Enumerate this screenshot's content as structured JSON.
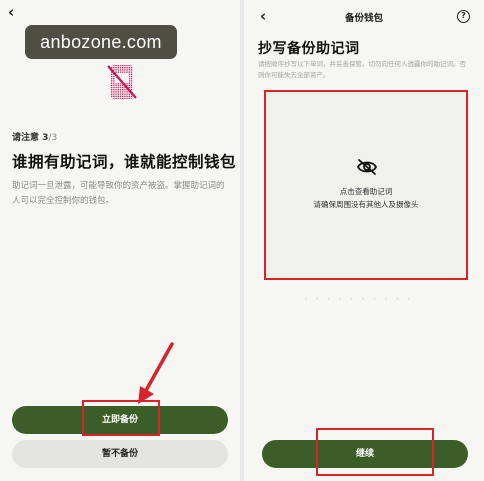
{
  "left_screen": {
    "watermark": "anbozone.com",
    "step_prefix": "请注意 3",
    "step_total": "/3",
    "headline": "谁拥有助记词，谁就能控制钱包",
    "warning": "助记词一旦泄露，可能导致你的资产被盗。掌握助记词的人可以完全控制你的钱包。",
    "primary_button": "立即备份",
    "secondary_button": "暂不备份",
    "icons": {
      "back": "back-arrow-icon",
      "illustration": "no-phone-icon"
    }
  },
  "right_screen": {
    "nav_title": "备份钱包",
    "help_icon": "?",
    "title": "抄写备份助记词",
    "description": "请按顺序抄写以下单词，并妥善保管。切勿向任何人透露你的助记词。否则你可能失去全部资产。",
    "reveal_line1": "点击查看助记词",
    "reveal_line2": "请确保周围没有其他人及摄像头",
    "continue_button": "继续",
    "icons": {
      "back": "back-arrow-icon",
      "eye": "eye-off-icon"
    }
  },
  "colors": {
    "primary_green": "#3b5d27",
    "highlight_red": "#d8232a",
    "background": "#f6f6f3"
  }
}
